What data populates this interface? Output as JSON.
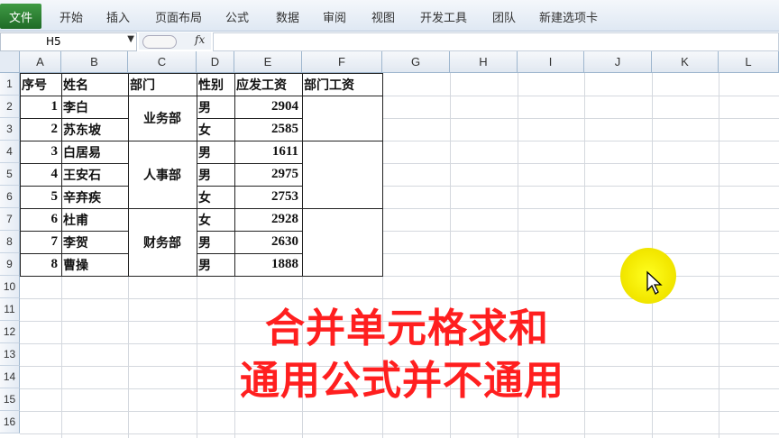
{
  "ribbon": {
    "file_tab": "文件",
    "tabs": [
      "开始",
      "插入",
      "页面布局",
      "公式",
      "数据",
      "审阅",
      "视图",
      "开发工具",
      "团队",
      "新建选项卡"
    ]
  },
  "formula_bar": {
    "name_box": "H5",
    "fx_label": "fx",
    "formula": ""
  },
  "sheet": {
    "columns": [
      "A",
      "B",
      "C",
      "D",
      "E",
      "F",
      "G",
      "H",
      "I",
      "J",
      "K",
      "L"
    ],
    "rows": [
      "1",
      "2",
      "3",
      "4",
      "5",
      "6",
      "7",
      "8",
      "9",
      "10",
      "11",
      "12",
      "13",
      "14",
      "15",
      "16"
    ],
    "headers": [
      "序号",
      "姓名",
      "部门",
      "性别",
      "应发工资",
      "部门工资"
    ],
    "records": [
      {
        "no": "1",
        "name": "李白",
        "gender": "男",
        "salary": "2904"
      },
      {
        "no": "2",
        "name": "苏东坡",
        "gender": "女",
        "salary": "2585"
      },
      {
        "no": "3",
        "name": "白居易",
        "gender": "男",
        "salary": "1611"
      },
      {
        "no": "4",
        "name": "王安石",
        "gender": "男",
        "salary": "2975"
      },
      {
        "no": "5",
        "name": "辛弃疾",
        "gender": "女",
        "salary": "2753"
      },
      {
        "no": "6",
        "name": "杜甫",
        "gender": "女",
        "salary": "2928"
      },
      {
        "no": "7",
        "name": "李贺",
        "gender": "男",
        "salary": "2630"
      },
      {
        "no": "8",
        "name": "曹操",
        "gender": "男",
        "salary": "1888"
      }
    ],
    "departments": [
      "业务部",
      "人事部",
      "财务部"
    ]
  },
  "overlay": {
    "line1": "合并单元格求和",
    "line2": "通用公式并不通用",
    "color": "#ff1f1f"
  },
  "colors": {
    "file_tab": "#2e7d32",
    "cursor_highlight": "#f3e800"
  }
}
